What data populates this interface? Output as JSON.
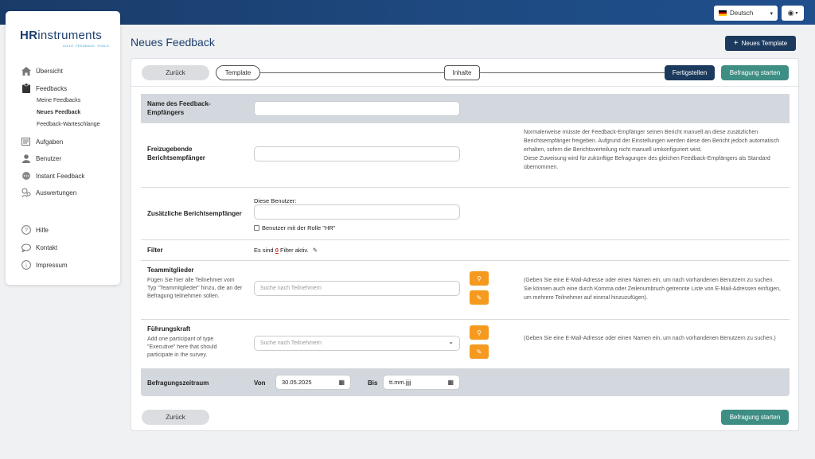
{
  "topbar": {
    "language": "Deutsch",
    "chevron": "▾",
    "user_icon": "◉",
    "user_chevron": "▾"
  },
  "logo": {
    "main_a": "HR",
    "main_b": "instruments",
    "sub": "AGILE. FEEDBACK. TOOLS."
  },
  "sidebar": {
    "items": [
      {
        "label": "Übersicht",
        "icon": "home-icon"
      },
      {
        "label": "Feedbacks",
        "icon": "clipboard-icon"
      },
      {
        "label": "Aufgaben",
        "icon": "tasks-icon"
      },
      {
        "label": "Benutzer",
        "icon": "user-icon"
      },
      {
        "label": "Instant Feedback",
        "icon": "chat-icon"
      },
      {
        "label": "Auswertungen",
        "icon": "analytics-icon"
      },
      {
        "label": "Hilfe",
        "icon": "help-icon"
      },
      {
        "label": "Kontakt",
        "icon": "speech-bubble-icon"
      },
      {
        "label": "Impressum",
        "icon": "info-icon"
      }
    ],
    "subitems": [
      "Meine Feedbacks",
      "Neues Feedback",
      "Feedback-Warteschlange"
    ]
  },
  "page": {
    "title": "Neues Feedback",
    "new_template": "Neues Template",
    "plus": "+"
  },
  "steps": {
    "back": "Zurück",
    "template": "Template",
    "inhalte": "Inhalte",
    "finish": "Fertigstellen",
    "start": "Befragung starten"
  },
  "form": {
    "recipient_label": "Name des Feedback-Empfängers",
    "share_label": "Freizugebende Berichtsempfänger",
    "share_note": "Normalerweise müsste der Feedback-Empfänger seinen Bericht manuell an diese zusätzlichen Berichtsempfänger freigeben. Aufgrund der Einstellungen werden diese den Bericht jedoch automatisch erhalten, sofern die Berichtsverteilung nicht manuell umkonfiguriert wird.",
    "share_note2": "Diese Zuweisung wird für zukünftige Befragungen des gleichen Feedback-Empfängers als Standard übernommen.",
    "extra_label": "Zusätzliche Berichtsempfänger",
    "these_users": "Diese Benutzer:",
    "hr_role": "Benutzer mit der Rolle \"HR\"",
    "filter_label": "Filter",
    "filter_pre": "Es sind",
    "filter_count": "0",
    "filter_post": "Filter aktiv.",
    "filter_edit": "✎",
    "team_label": "Teammitglieder",
    "team_desc": "Fügen Sie hier alle Teilnehmer vom Typ \"Teammitglieder\" hinzu, die an der Befragung teilnehmen sollen.",
    "team_placeholder": "Suche nach Teilnehmern",
    "team_note": "(Geben Sie eine E-Mail-Adresse oder einen Namen ein, um nach vorhandenen Benutzern zu suchen. Sie können auch eine durch Komma oder Zeilenumbruch getrennte Liste von E-Mail-Adressen einfügen, um mehrere Teilnehmer auf einmal hinzuzufügen).",
    "lead_label": "Führungskraft",
    "lead_desc": "Add one participant of type \"Executive\" here that should participate in the survey.",
    "lead_placeholder": "Suche nach Teilnehmern",
    "lead_note": "(Geben Sie eine E-Mail-Adresse oder einen Namen ein, um nach vorhandenen Benutzern zu suchen.)",
    "period_label": "Befragungszeitraum",
    "from_label": "Von",
    "from_value": "30.05.2025",
    "to_label": "Bis",
    "to_value": "tt.mm.jjjj",
    "search_icon": "⚲",
    "pencil_icon": "✎",
    "calendar_icon": "▦",
    "select_chevron": "⌄"
  },
  "footer": {
    "back": "Zurück",
    "start": "Befragung starten"
  }
}
